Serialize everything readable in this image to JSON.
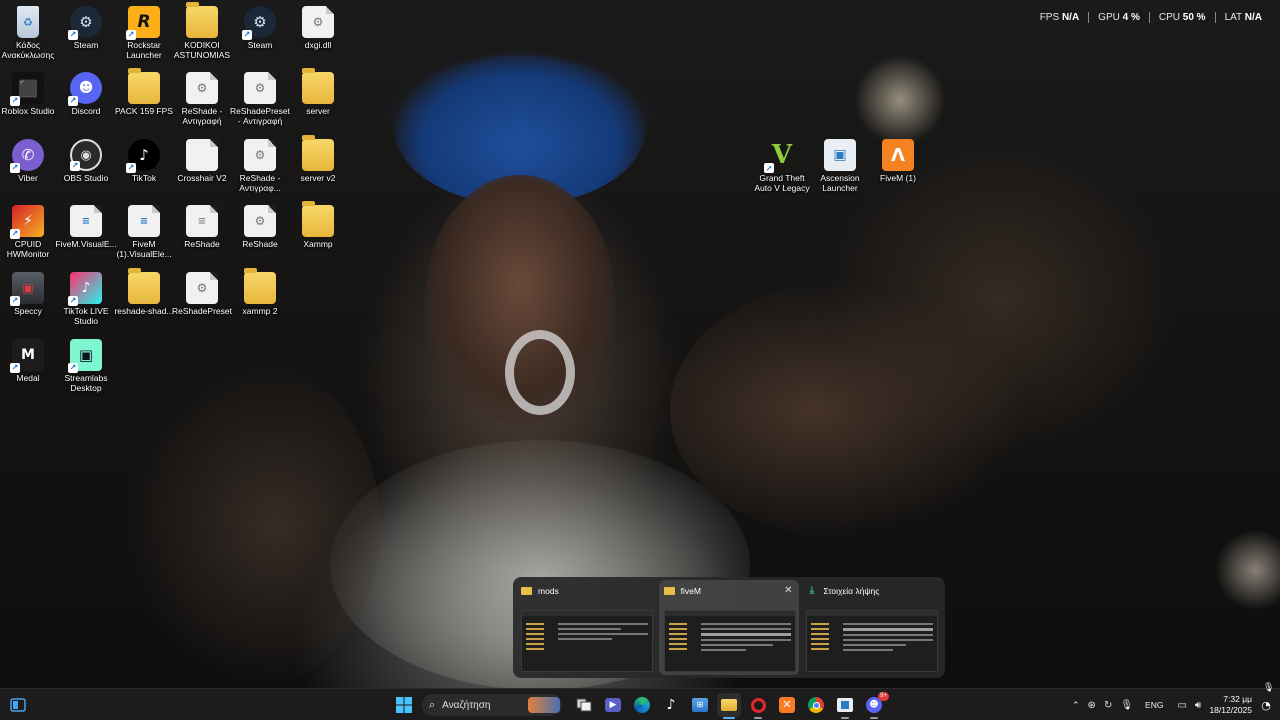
{
  "desktop": {
    "icons": [
      {
        "label": "Κάδος Ανακύκλωσης",
        "icon": "recycle-bin-icon"
      },
      {
        "label": "Steam",
        "icon": "steam-icon"
      },
      {
        "label": "Rockstar Launcher",
        "icon": "rockstar-icon"
      },
      {
        "label": "KODIKOI ASTUNOMIAS",
        "icon": "folder-icon"
      },
      {
        "label": "Steam",
        "icon": "steam-icon"
      },
      {
        "label": "dxgi.dll",
        "icon": "dll-file-icon"
      },
      {
        "label": "Roblox Studio",
        "icon": "roblox-icon"
      },
      {
        "label": "Discord",
        "icon": "discord-icon"
      },
      {
        "label": "PACK 159 FPS",
        "icon": "folder-icon"
      },
      {
        "label": "ReShade - Αντιγραφή",
        "icon": "settings-file-icon"
      },
      {
        "label": "ReShadePreset - Αντιγραφή",
        "icon": "settings-file-icon"
      },
      {
        "label": "server",
        "icon": "folder-icon"
      },
      {
        "label": "Viber",
        "icon": "viber-icon"
      },
      {
        "label": "OBS Studio",
        "icon": "obs-icon"
      },
      {
        "label": "TikTok",
        "icon": "tiktok-icon"
      },
      {
        "label": "Crosshair V2",
        "icon": "document-icon"
      },
      {
        "label": "ReShade - Αντιγραφ...",
        "icon": "settings-file-icon"
      },
      {
        "label": "server v2",
        "icon": "folder-icon"
      },
      {
        "label": "CPUID HWMonitor",
        "icon": "hwmonitor-icon"
      },
      {
        "label": "FiveM.VisualE...",
        "icon": "manifest-file-icon"
      },
      {
        "label": "FiveM (1).VisualEle...",
        "icon": "manifest-file-icon"
      },
      {
        "label": "ReShade",
        "icon": "text-file-icon"
      },
      {
        "label": "ReShade",
        "icon": "settings-file-icon"
      },
      {
        "label": "Xammp",
        "icon": "folder-icon"
      },
      {
        "label": "Speccy",
        "icon": "speccy-icon"
      },
      {
        "label": "TikTok LIVE Studio",
        "icon": "tiktok-live-icon"
      },
      {
        "label": "reshade-shad...",
        "icon": "folder-icon"
      },
      {
        "label": "ReShadePreset",
        "icon": "settings-file-icon"
      },
      {
        "label": "xammp 2",
        "icon": "folder-icon"
      },
      {
        "label": "Medal",
        "icon": "medal-icon"
      },
      {
        "label": "Streamlabs Desktop",
        "icon": "streamlabs-icon"
      },
      {
        "label": "Grand Theft Auto V Legacy",
        "icon": "gta-v-icon"
      },
      {
        "label": "Ascension Launcher",
        "icon": "ascension-icon"
      },
      {
        "label": "FiveM (1)",
        "icon": "fivem-icon"
      }
    ]
  },
  "stats": {
    "fps_label": "FPS",
    "fps_value": "N/A",
    "gpu_label": "GPU",
    "gpu_value": "4 %",
    "cpu_label": "CPU",
    "cpu_value": "50 %",
    "lat_label": "LAT",
    "lat_value": "N/A"
  },
  "thumbnails": [
    {
      "title": "mods",
      "icon": "folder-icon"
    },
    {
      "title": "fiveM",
      "icon": "folder-icon",
      "close": "✕"
    },
    {
      "title": "Στοιχεία λήψης",
      "icon": "download-icon"
    }
  ],
  "taskbar": {
    "search_placeholder": "Αναζήτηση",
    "language": "ENG",
    "time": "7:32 μμ",
    "date": "18/12/2025",
    "discord_badge": "9+"
  }
}
